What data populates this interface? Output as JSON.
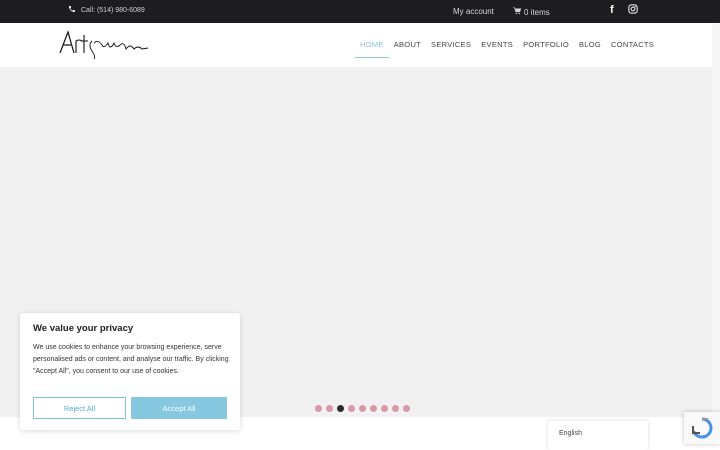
{
  "topbar": {
    "phone": "Call: (514) 980-6089",
    "account": "My account",
    "cart": "0 items"
  },
  "icons": {
    "phone": "phone-icon",
    "cart": "cart-icon",
    "facebook": "facebook-icon",
    "instagram": "instagram-icon",
    "recaptcha": "recaptcha-icon"
  },
  "nav": {
    "items": [
      "HOME",
      "ABOUT",
      "SERVICES",
      "EVENTS",
      "PORTFOLIO",
      "BLOG",
      "CONTACTS"
    ]
  },
  "hero": {
    "slide_count": 9,
    "active_slide": 3
  },
  "cookie": {
    "title": "We value your privacy",
    "body": "We use cookies to enhance your browsing experience, serve personalised ads or content, and analyse our traffic. By clicking \"Accept All\", you consent to our use of cookies.",
    "reject": "Reject All",
    "accept": "Accept All"
  },
  "language": {
    "current": "English"
  },
  "colors": {
    "accent": "#86c8df",
    "dot": "#d898a8",
    "dark": "#1d1d1f"
  }
}
